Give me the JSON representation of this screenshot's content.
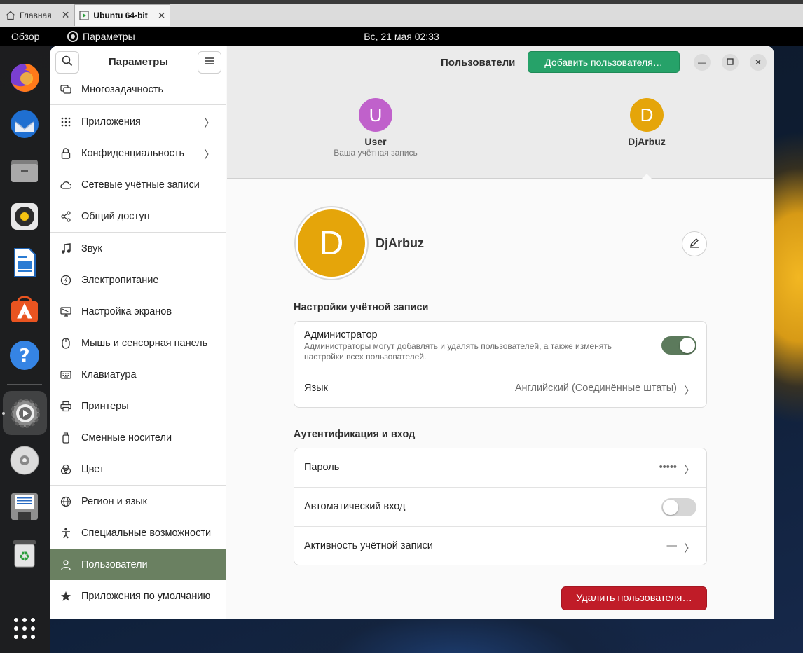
{
  "vm_tabs": [
    {
      "label": "Главная"
    },
    {
      "label": "Ubuntu 64-bit"
    }
  ],
  "topbar": {
    "overview": "Обзор",
    "app_menu": "Параметры",
    "clock": "Вс, 21 мая  02:33"
  },
  "dock": {
    "apps": [
      "firefox-icon",
      "thunderbird-icon",
      "files-icon",
      "rhythmbox-icon",
      "writer-icon",
      "app-center-icon",
      "help-icon",
      "settings-icon",
      "dvd-icon",
      "floppy-icon",
      "trash-icon",
      "show-apps-icon"
    ]
  },
  "sidebar": {
    "title": "Параметры",
    "items": [
      {
        "label": "Многозадачность",
        "icon": "multitasking-icon"
      },
      {
        "label": "Приложения",
        "icon": "apps-grid-icon"
      },
      {
        "label": "Конфиденциальность",
        "icon": "lock-icon"
      },
      {
        "label": "Сетевые учётные записи",
        "icon": "cloud-icon"
      },
      {
        "label": "Общий доступ",
        "icon": "share-icon"
      },
      {
        "label": "Звук",
        "icon": "music-note-icon"
      },
      {
        "label": "Электропитание",
        "icon": "power-icon"
      },
      {
        "label": "Настройка экранов",
        "icon": "display-icon"
      },
      {
        "label": "Мышь и сенсорная панель",
        "icon": "mouse-icon"
      },
      {
        "label": "Клавиатура",
        "icon": "keyboard-icon"
      },
      {
        "label": "Принтеры",
        "icon": "printer-icon"
      },
      {
        "label": "Сменные носители",
        "icon": "usb-drive-icon"
      },
      {
        "label": "Цвет",
        "icon": "color-icon"
      },
      {
        "label": "Регион и язык",
        "icon": "globe-icon"
      },
      {
        "label": "Специальные возможности",
        "icon": "accessibility-icon"
      },
      {
        "label": "Пользователи",
        "icon": "users-icon"
      },
      {
        "label": "Приложения по умолчанию",
        "icon": "star-icon"
      }
    ],
    "selected": "Пользователи"
  },
  "header": {
    "title": "Пользователи",
    "add_user": "Добавить пользователя…"
  },
  "users": [
    {
      "initial": "U",
      "name": "User",
      "subtitle": "Ваша учётная запись",
      "color": "#c061cb"
    },
    {
      "initial": "D",
      "name": "DjArbuz",
      "subtitle": "",
      "color": "#e5a50a"
    }
  ],
  "profile": {
    "initial": "D",
    "name": "DjArbuz"
  },
  "account_settings": {
    "title": "Настройки учётной записи",
    "admin_label": "Администратор",
    "admin_desc": "Администраторы могут добавлять и удалять пользователей, а также изменять настройки всех пользователей.",
    "admin_enabled": true,
    "language_label": "Язык",
    "language_value": "Английский (Соединённые штаты)"
  },
  "auth": {
    "title": "Аутентификация и вход",
    "password_label": "Пароль",
    "password_value": "•••••",
    "autologin_label": "Автоматический вход",
    "autologin_enabled": false,
    "activity_label": "Активность учётной записи",
    "activity_value": "—"
  },
  "delete_user": "Удалить пользователя…"
}
